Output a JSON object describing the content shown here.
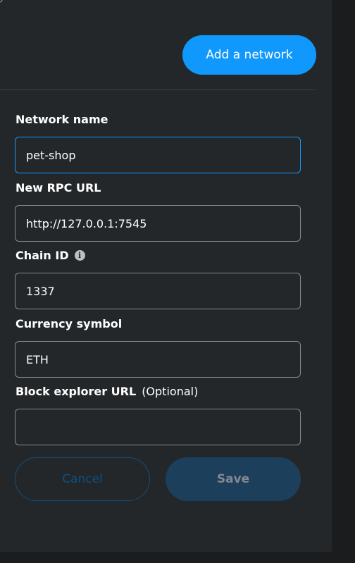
{
  "header": {
    "add_network_label": "Add a network"
  },
  "form": {
    "network_name": {
      "label": "Network name",
      "value": "pet-shop"
    },
    "rpc_url": {
      "label": "New RPC URL",
      "value": "http://127.0.0.1:7545"
    },
    "chain_id": {
      "label": "Chain ID",
      "info_icon": "i",
      "value": "1337"
    },
    "currency_symbol": {
      "label": "Currency symbol",
      "value": "ETH"
    },
    "block_explorer": {
      "label": "Block explorer URL",
      "optional": "(Optional)",
      "value": ""
    }
  },
  "actions": {
    "cancel_label": "Cancel",
    "save_label": "Save"
  },
  "colors": {
    "accent": "#1098fc",
    "panel_bg": "#24272a",
    "save_disabled_bg": "#1c3f5c",
    "cancel_border": "#0f4f80"
  }
}
